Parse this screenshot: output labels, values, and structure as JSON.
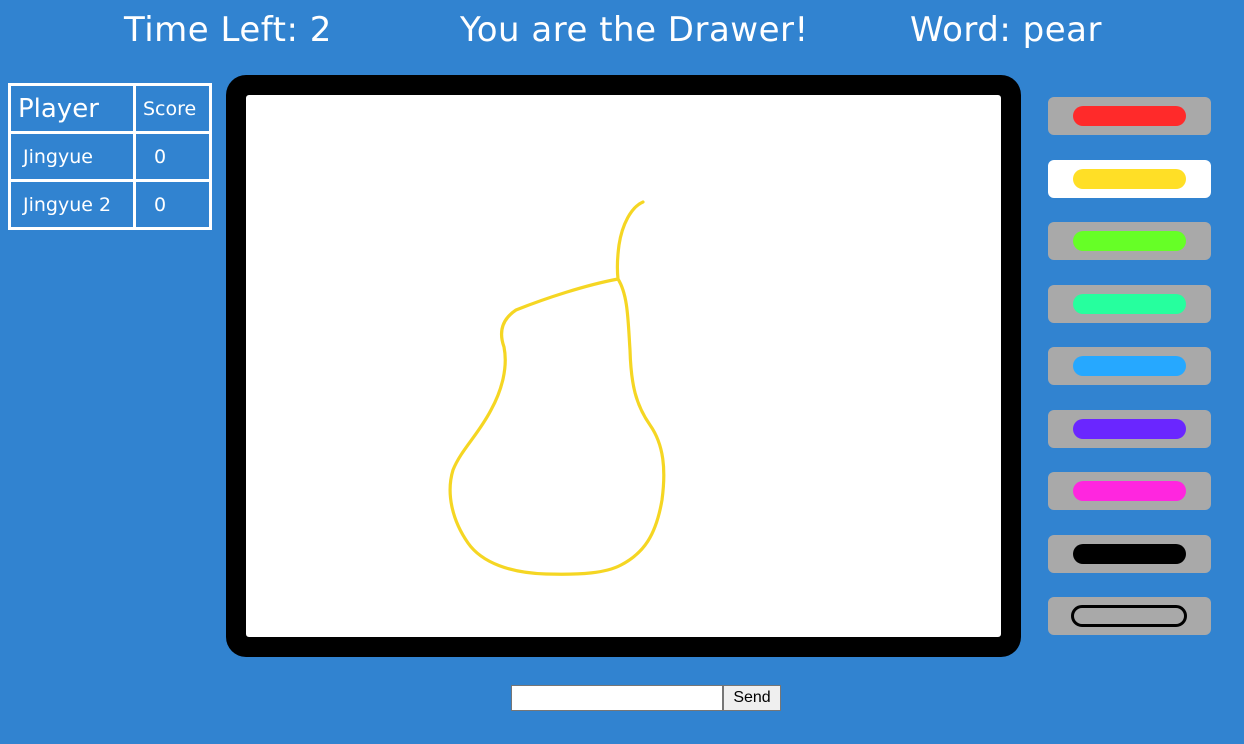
{
  "header": {
    "time_left": "Time Left: 2",
    "role": "You are the Drawer!",
    "word": "Word: pear"
  },
  "scoreboard": {
    "headers": [
      "Player",
      "Score"
    ],
    "rows": [
      {
        "player": "Jingyue",
        "score": "0"
      },
      {
        "player": "Jingyue 2",
        "score": "0"
      }
    ]
  },
  "canvas": {
    "stroke_color": "#f5d623",
    "drawing": "pear"
  },
  "palette": {
    "selected": "yellow",
    "colors": [
      {
        "name": "red",
        "hex": "#ff2a2a"
      },
      {
        "name": "yellow",
        "hex": "#ffdf26"
      },
      {
        "name": "green",
        "hex": "#66ff26"
      },
      {
        "name": "teal",
        "hex": "#26ff9e"
      },
      {
        "name": "blue",
        "hex": "#26a8ff"
      },
      {
        "name": "purple",
        "hex": "#6a26ff"
      },
      {
        "name": "pink",
        "hex": "#ff26df"
      },
      {
        "name": "black",
        "hex": "#000000"
      },
      {
        "name": "eraser",
        "hex": "#a9a9a9"
      }
    ]
  },
  "chat": {
    "input_value": "",
    "send_label": "Send"
  }
}
